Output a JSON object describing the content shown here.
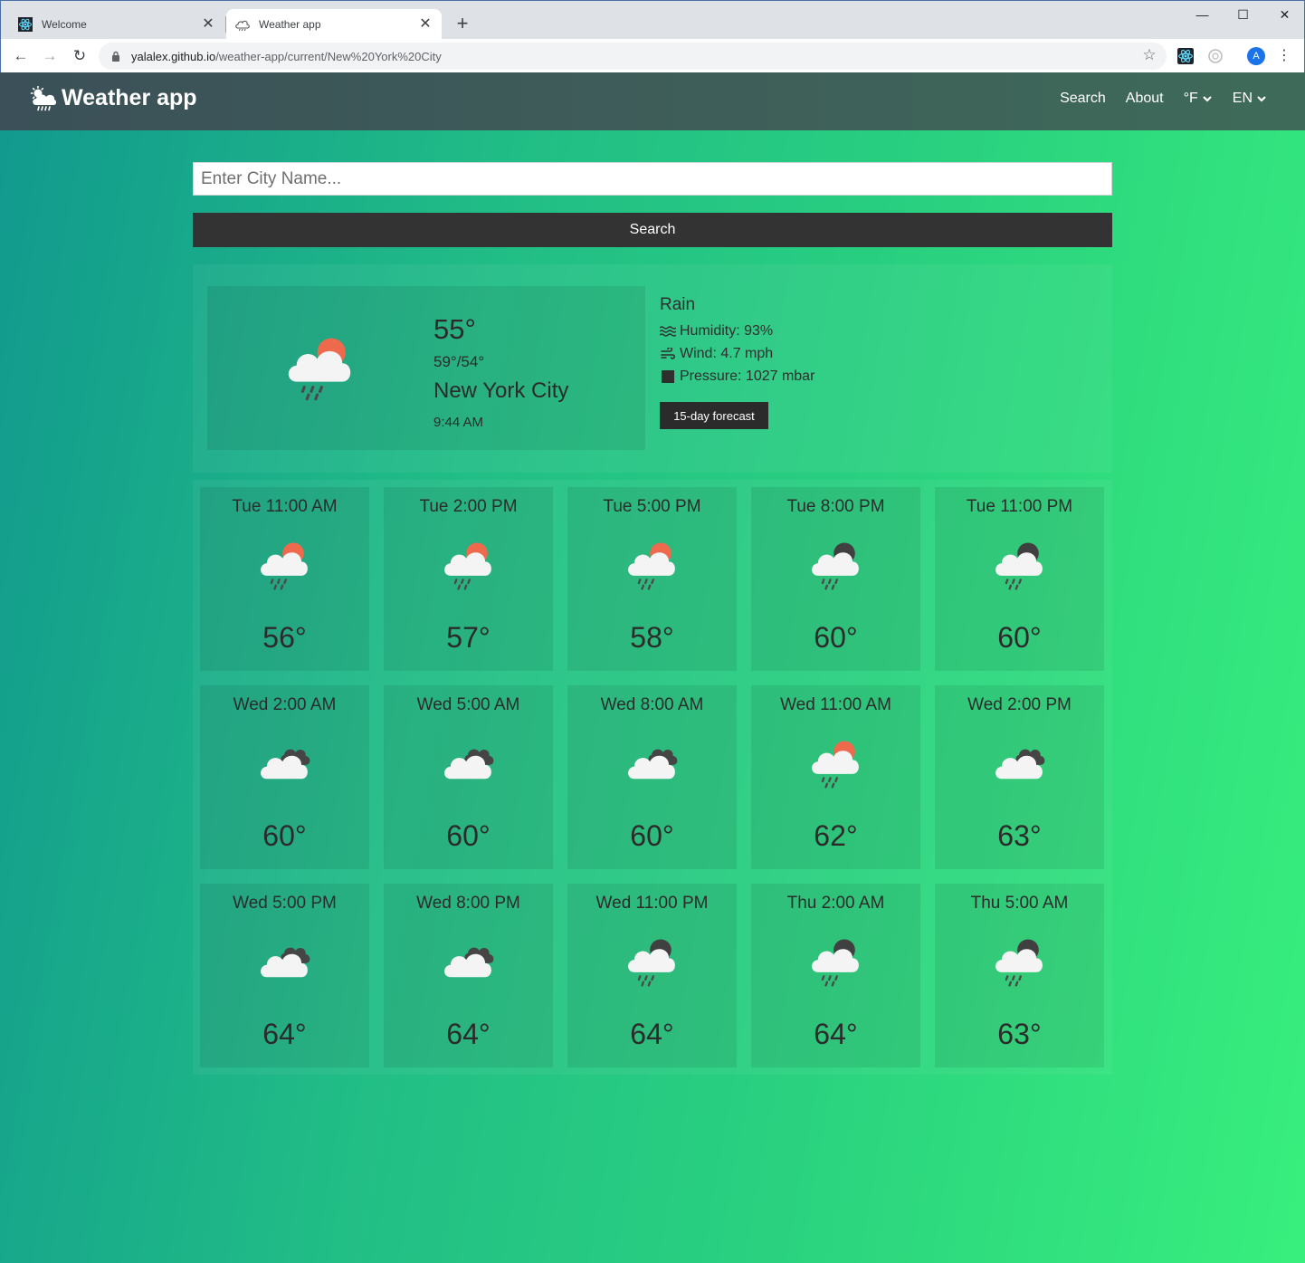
{
  "browser": {
    "tabs": [
      {
        "title": "Welcome",
        "active": false
      },
      {
        "title": "Weather app",
        "active": true
      }
    ],
    "url_host": "yalalex.github.io",
    "url_path": "/weather-app/current/New%20York%20City",
    "profile_initial": "A"
  },
  "nav": {
    "brand": "Weather app",
    "links": {
      "search": "Search",
      "about": "About",
      "units": "°F",
      "lang": "EN"
    }
  },
  "search": {
    "placeholder": "Enter City Name...",
    "button": "Search"
  },
  "current": {
    "temp": "55°",
    "range": "59°/54°",
    "city": "New York City",
    "time": "9:44 AM",
    "condition": "Rain",
    "humidity": "Humidity: 93%",
    "wind": "Wind: 4.7 mph",
    "pressure": "Pressure: 1027 mbar",
    "forecast_button": "15-day forecast",
    "icon": "rain-sun-icon"
  },
  "hourly": [
    {
      "time": "Tue 11:00 AM",
      "temp": "56°",
      "icon": "rain-sun-icon"
    },
    {
      "time": "Tue 2:00 PM",
      "temp": "57°",
      "icon": "rain-sun-icon"
    },
    {
      "time": "Tue 5:00 PM",
      "temp": "58°",
      "icon": "rain-sun-icon"
    },
    {
      "time": "Tue 8:00 PM",
      "temp": "60°",
      "icon": "rain-night-icon"
    },
    {
      "time": "Tue 11:00 PM",
      "temp": "60°",
      "icon": "rain-night-icon"
    },
    {
      "time": "Wed 2:00 AM",
      "temp": "60°",
      "icon": "cloudy-icon"
    },
    {
      "time": "Wed 5:00 AM",
      "temp": "60°",
      "icon": "cloudy-icon"
    },
    {
      "time": "Wed 8:00 AM",
      "temp": "60°",
      "icon": "cloudy-icon"
    },
    {
      "time": "Wed 11:00 AM",
      "temp": "62°",
      "icon": "rain-sun-icon"
    },
    {
      "time": "Wed 2:00 PM",
      "temp": "63°",
      "icon": "cloudy-icon"
    },
    {
      "time": "Wed 5:00 PM",
      "temp": "64°",
      "icon": "cloudy-icon"
    },
    {
      "time": "Wed 8:00 PM",
      "temp": "64°",
      "icon": "cloudy-icon"
    },
    {
      "time": "Wed 11:00 PM",
      "temp": "64°",
      "icon": "rain-night-icon"
    },
    {
      "time": "Thu 2:00 AM",
      "temp": "64°",
      "icon": "rain-night-icon"
    },
    {
      "time": "Thu 5:00 AM",
      "temp": "63°",
      "icon": "rain-night-icon"
    }
  ],
  "colors": {
    "gradient_start": "#11998e",
    "gradient_end": "#38ef7d",
    "navbar": "#3e5d59",
    "button": "#333333",
    "sun": "#ef6a4c",
    "dark_cloud": "#444444"
  }
}
